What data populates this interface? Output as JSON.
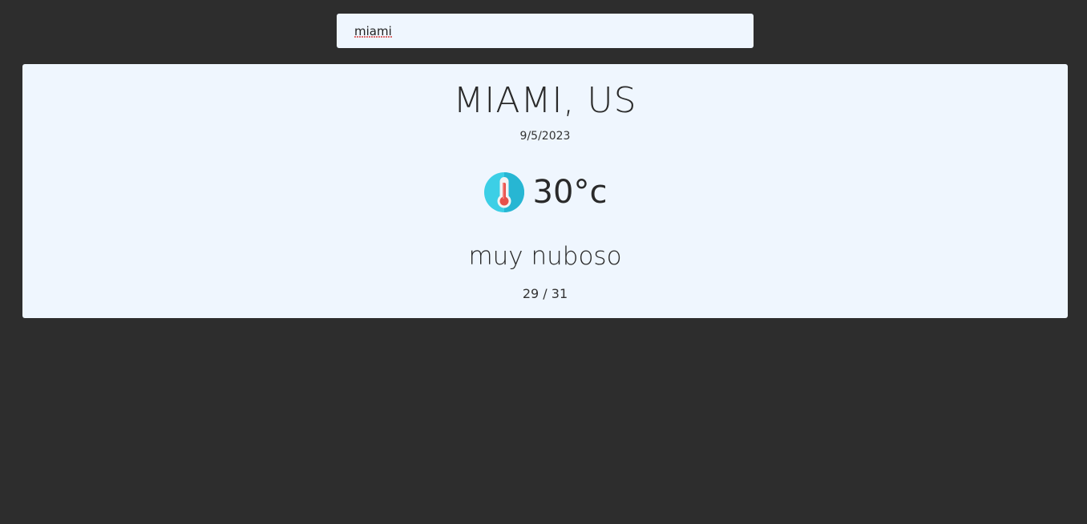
{
  "search": {
    "value": "miami",
    "placeholder": ""
  },
  "weather": {
    "city": "MIAMI, US",
    "date": "9/5/2023",
    "temperature": "30°c",
    "description": "muy nuboso",
    "range": "29 / 31",
    "icon": "thermometer-icon"
  },
  "colors": {
    "background": "#2d2d2d",
    "card": "#eff6fe",
    "icon_circle": "#3ccfe6",
    "icon_mercury": "#e8504a"
  }
}
